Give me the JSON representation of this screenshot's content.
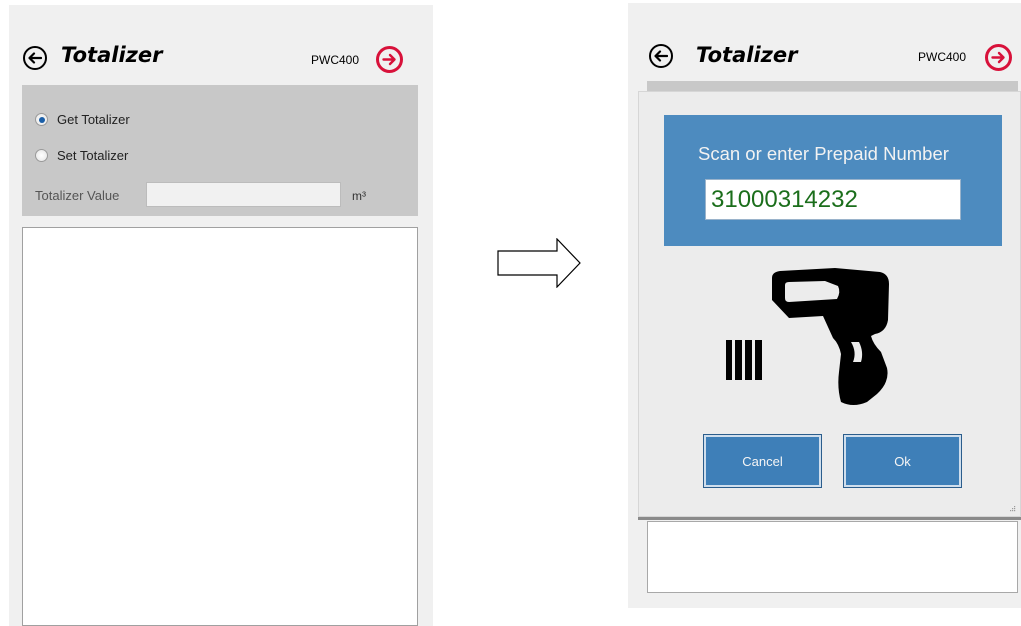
{
  "left_screen": {
    "title": "Totalizer",
    "device": "PWC400",
    "options": [
      {
        "label": "Get Totalizer",
        "selected": true
      },
      {
        "label": "Set Totalizer",
        "selected": false
      }
    ],
    "field_label": "Totalizer Value",
    "field_value": "",
    "unit": "m³"
  },
  "right_screen": {
    "title": "Totalizer",
    "device": "PWC400",
    "dialog": {
      "prompt": "Scan or enter Prepaid Number",
      "prepaid_number": "31000314232",
      "cancel_label": "Cancel",
      "ok_label": "Ok"
    }
  },
  "icons": {
    "back": "back-arrow-circle-icon",
    "forward": "forward-arrow-circle-icon",
    "transition": "right-arrow-icon",
    "scanner": "barcode-scanner-icon"
  },
  "colors": {
    "accent_red": "#d8113a",
    "dialog_blue": "#4d8bbf",
    "button_blue": "#3e7fb8",
    "number_green": "#1b6e1b"
  }
}
